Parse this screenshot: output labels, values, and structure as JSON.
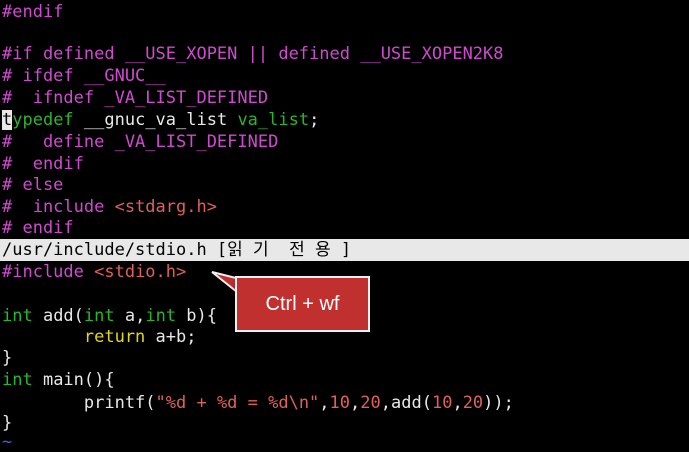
{
  "editor": {
    "top_lines": [
      {
        "text": "#endif",
        "cls": "magenta"
      },
      {
        "text": "",
        "cls": "magenta"
      },
      {
        "text": "#if defined __USE_XOPEN || defined __USE_XOPEN2K8",
        "cls": "magenta"
      },
      {
        "text": "# ifdef __GNUC__",
        "cls": "magenta"
      },
      {
        "text": "#  ifndef _VA_LIST_DEFINED",
        "cls": "magenta"
      }
    ],
    "typedef_line": {
      "cursor_char": "t",
      "kw": "ypedef",
      "rest": " __gnuc_va_list ",
      "type": "va_list",
      "end": ";"
    },
    "mid_lines": [
      {
        "text": "#   define _VA_LIST_DEFINED",
        "cls": "magenta"
      },
      {
        "text": "#  endif",
        "cls": "magenta"
      },
      {
        "text": "# else",
        "cls": "magenta"
      },
      {
        "text": "#  include ",
        "cls": "magenta",
        "extra": "<stdarg.h>"
      },
      {
        "text": "# endif",
        "cls": "magenta"
      }
    ],
    "status_bar": "/usr/include/stdio.h [읽 기  전 용 ]",
    "include_line": {
      "directive": "#include ",
      "header": "<stdio.h>"
    },
    "code": {
      "int_kw": "int",
      "add_line_a": " add(",
      "add_line_b": " a,",
      "add_line_c": " b){",
      "return_kw": "        return",
      "return_rest": " a+b;",
      "close_brace": "}",
      "main_rest": " main(){",
      "printf_a": "        printf(",
      "printf_str": "\"%d + %d = %d\\n\"",
      "printf_b": ",",
      "n10": "10",
      "comma": ",",
      "n20": "20",
      "printf_c": ",add(",
      "printf_end": "));"
    },
    "tilde": "~"
  },
  "callout": {
    "label": "Ctrl + wf"
  }
}
